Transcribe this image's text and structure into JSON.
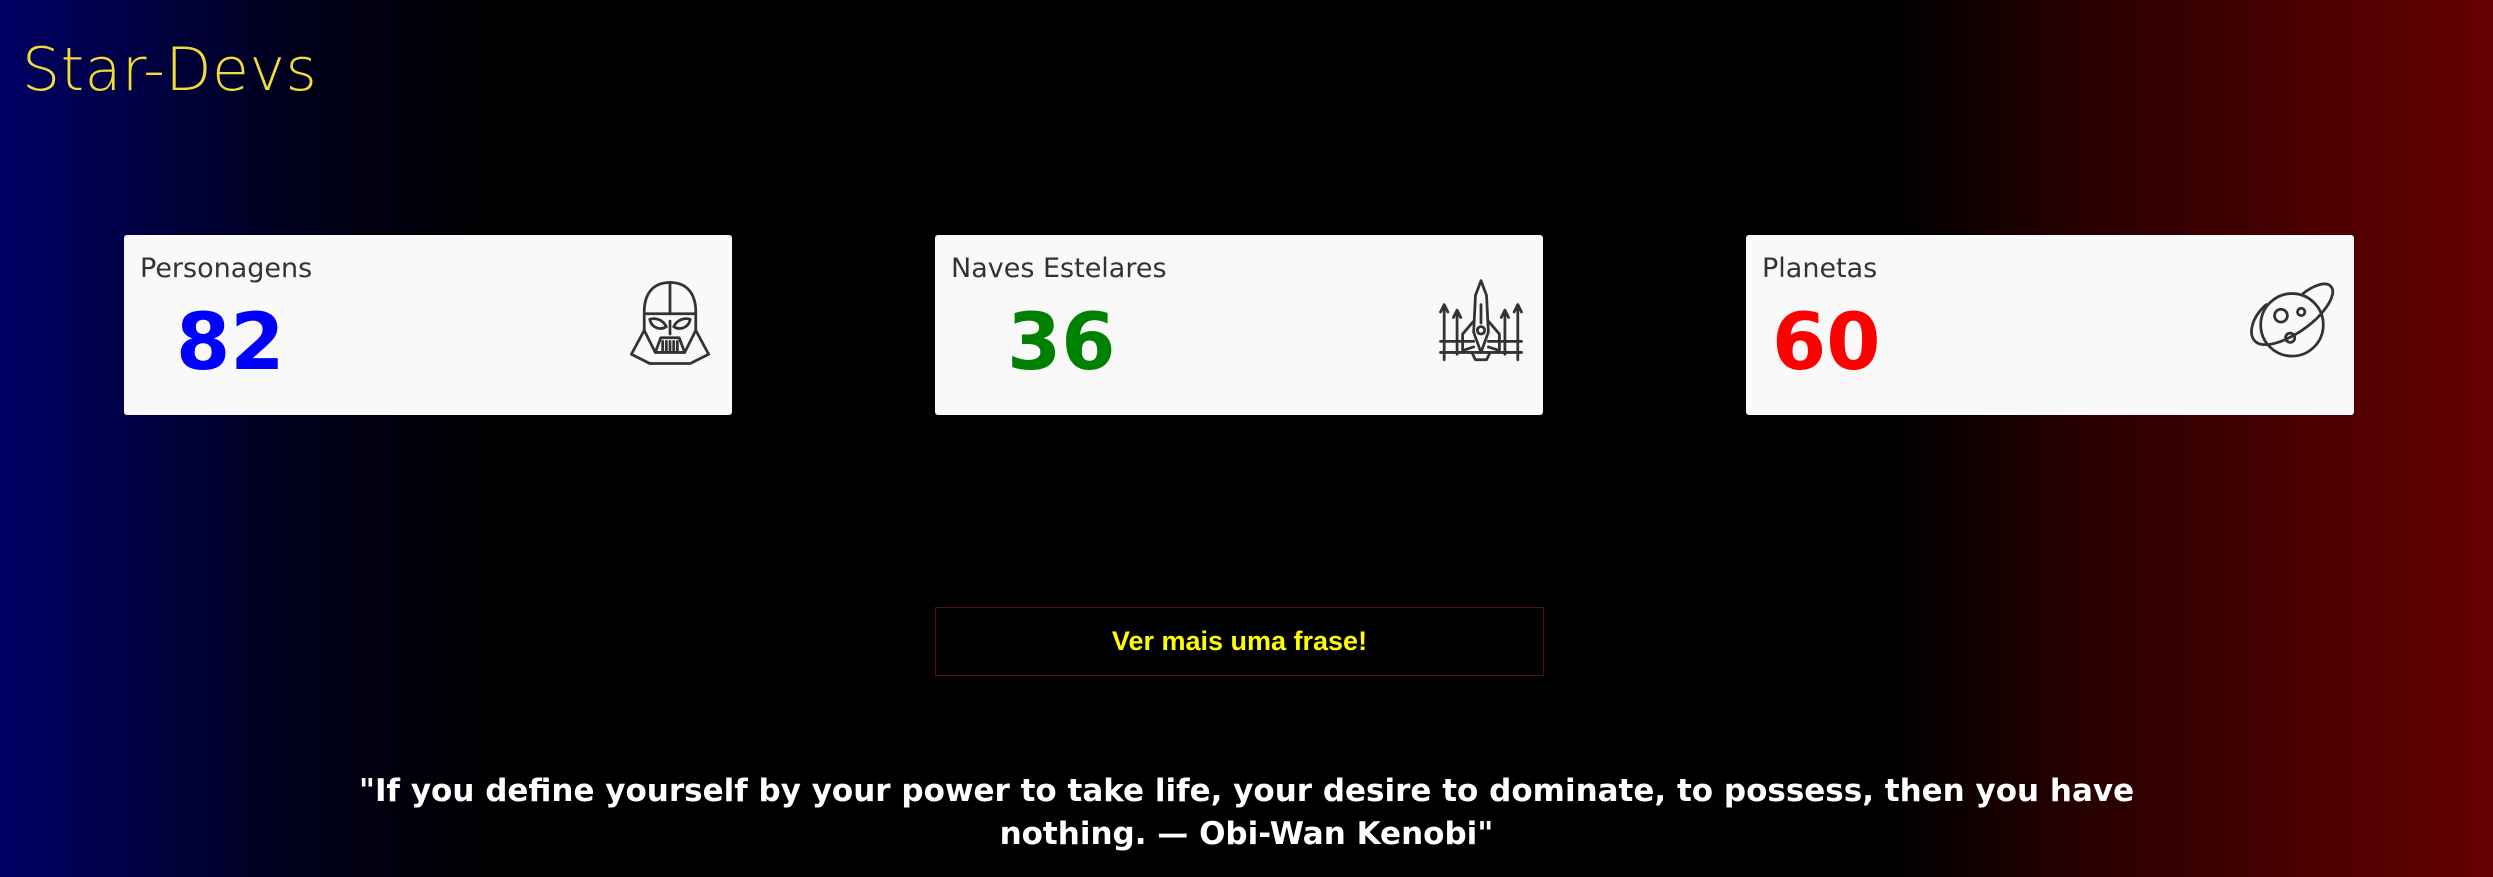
{
  "header": {
    "title": "Star-Devs"
  },
  "cards": [
    {
      "label": "Personagens",
      "value": "82",
      "color": "#0000ff",
      "icon": "darth-vader-helmet-icon"
    },
    {
      "label": "Naves Estelares",
      "value": "36",
      "color": "#008000",
      "icon": "starship-icon"
    },
    {
      "label": "Planetas",
      "value": "60",
      "color": "#ff0000",
      "icon": "planet-icon"
    }
  ],
  "action": {
    "button_label": "Ver mais uma frase!"
  },
  "quote": {
    "text": "\"If you define yourself by your power to take life, your desire to dominate, to possess, then you have nothing. — Obi-Wan Kenobi\""
  },
  "colors": {
    "title": "#f2dd35",
    "button_text": "#ffff00"
  }
}
